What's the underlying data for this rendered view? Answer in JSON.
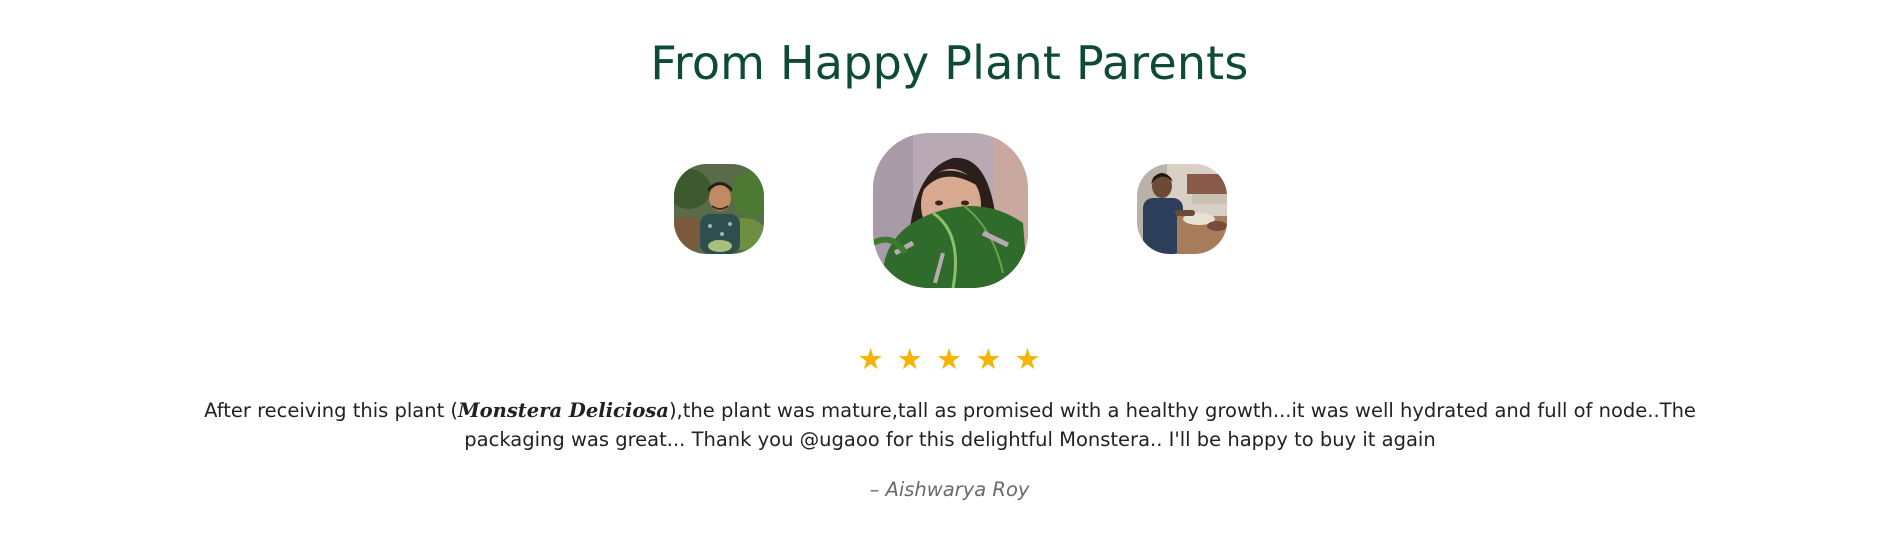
{
  "section": {
    "title": "From Happy Plant Parents"
  },
  "avatars": [
    {
      "name": "reviewer-avatar-left",
      "selected": false
    },
    {
      "name": "reviewer-avatar-center",
      "selected": true
    },
    {
      "name": "reviewer-avatar-right",
      "selected": false
    }
  ],
  "rating": {
    "value": 5,
    "max": 5,
    "star_glyph": "★",
    "color": "#f6b400"
  },
  "review": {
    "text_before": "After receiving this plant (",
    "plant_name": "Monstera Deliciosa",
    "text_after": "),the plant was mature,tall as promised with a healthy growth...it was well hydrated and full of node..The packaging was great... Thank you @ugaoo for this delightful Monstera.. I'll be happy to buy it again",
    "author": "– Aishwarya Roy"
  },
  "colors": {
    "title": "#0d4b35",
    "text": "#222222",
    "author": "#6a6a6a",
    "background": "#ffffff"
  }
}
